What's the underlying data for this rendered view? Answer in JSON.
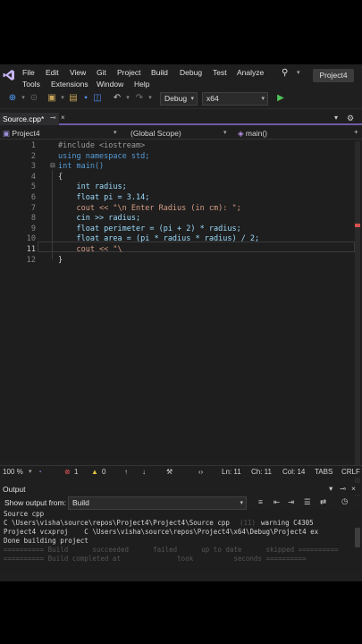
{
  "menu": {
    "items": [
      "File",
      "Edit",
      "View",
      "Git",
      "Project",
      "Build",
      "Debug",
      "Test",
      "Analyze",
      "Tools",
      "Extensions",
      "Window",
      "Help"
    ],
    "project_badge": "Project4"
  },
  "toolbar": {
    "config": "Debug",
    "platform": "x64"
  },
  "tabs": {
    "active": "Source.cpp*"
  },
  "navbar": {
    "project": "Project4",
    "scope": "(Global Scope)",
    "member": "main()"
  },
  "editor": {
    "line_numbers": [
      "1",
      "2",
      "3",
      "4",
      "5",
      "6",
      "7",
      "8",
      "9",
      "10",
      "11",
      "12"
    ],
    "lines": [
      "#include <iostream>",
      "using namespace std;",
      "int main()",
      "{",
      "    int radius;",
      "    float pi = 3.14;",
      "    cout << \"\\n Enter Radius (in cm): \";",
      "    cin >> radius;",
      "    float perimeter = (pi + 2) * radius;",
      "    float area = (pi * radius * radius) / 2;",
      "    cout << \"\\",
      "}"
    ]
  },
  "status": {
    "zoom": "100 %",
    "errors": "1",
    "warnings": "0",
    "ln": "Ln: 11",
    "ch": "Ch: 11",
    "col": "Col: 14",
    "tabs": "TABS",
    "eol": "CRLF"
  },
  "output": {
    "title": "Output",
    "show_from_label": "Show output from:",
    "source": "Build",
    "lines": [
      "Source cpp",
      "C \\Users\\visha\\source\\repos\\Project4\\Project4\\Source cpp",
      "Project4 vcxproj    C \\Users\\visha\\source\\repos\\Project4\\x64\\Debug\\Project4 ex",
      "Done building project",
      "========== Build      succeeded      failed      up to date      skipped ==========",
      "========== Build completed at              took          seconds =========="
    ],
    "warning_text": "warning C4305",
    "line_ref": "(11)"
  }
}
